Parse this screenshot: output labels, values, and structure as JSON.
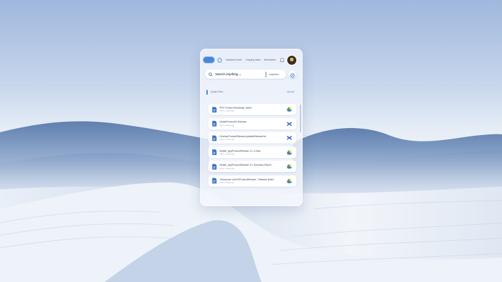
{
  "topbar": {
    "nav": [
      {
        "label": "Assistant home"
      },
      {
        "label": "Ongoing tasks"
      },
      {
        "label": "Bookmarks"
      }
    ]
  },
  "search": {
    "text": "Search anything ...",
    "scope": "Anywhere"
  },
  "quick_files": {
    "title": "Quick Files",
    "see_all": "See All",
    "items": [
      {
        "name": "RPC Product Roadmap_Week",
        "meta": "Docs • 2 days ago",
        "source": "drive"
      },
      {
        "name": "MobileProductUI Release",
        "meta": "Docs • 2 days ago",
        "source": "confluence"
      },
      {
        "name": "DesktopProductReleaseUpdatesReleaseVer",
        "meta": "Docs • 2 days ago",
        "source": "confluence"
      },
      {
        "name": "Mobile_AppProductRelease 4.1.2 Note",
        "meta": "Docs • 2 days ago",
        "source": "drive"
      },
      {
        "name": "Mobile_AppProductRelease 4.1 Summary Report",
        "meta": "Docs • 2 days ago",
        "source": "drive"
      },
      {
        "name": "Virtual plan UA/UXProductRelease - Release Notes",
        "meta": "Docs • 2 days ago",
        "source": "drive"
      }
    ]
  },
  "colors": {
    "accent": "#4a86d8",
    "drive_yellow": "#f5c542",
    "drive_green": "#2ea162",
    "drive_blue": "#3b7be0",
    "confluence_blue": "#2f6fd6"
  }
}
